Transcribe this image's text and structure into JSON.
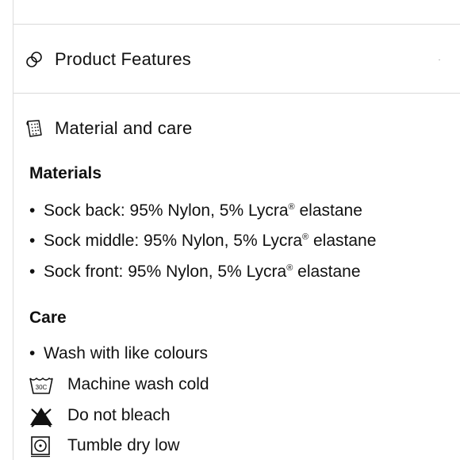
{
  "accordion": {
    "product_features": {
      "title": "Product Features",
      "icon": "overlapping-circles-icon"
    },
    "material_and_care": {
      "title": "Material and care",
      "icon": "fabric-tag-icon"
    }
  },
  "materials": {
    "heading": "Materials",
    "items": [
      {
        "prefix": "Sock back: 95% Nylon, 5% Lycra",
        "suffix": " elastane",
        "mark": "®"
      },
      {
        "prefix": "Sock middle: 95% Nylon, 5% Lycra",
        "suffix": " elastane",
        "mark": "®"
      },
      {
        "prefix": "Sock front: 95% Nylon, 5% Lycra",
        "suffix": " elastane",
        "mark": "®"
      }
    ]
  },
  "care": {
    "heading": "Care",
    "bullet": "Wash with like colours",
    "instructions": [
      {
        "label": "Machine wash cold",
        "icon": "wash-30c-icon",
        "icon_text": "30C"
      },
      {
        "label": "Do not bleach",
        "icon": "no-bleach-icon"
      },
      {
        "label": "Tumble dry low",
        "icon": "tumble-dry-low-icon"
      }
    ]
  }
}
